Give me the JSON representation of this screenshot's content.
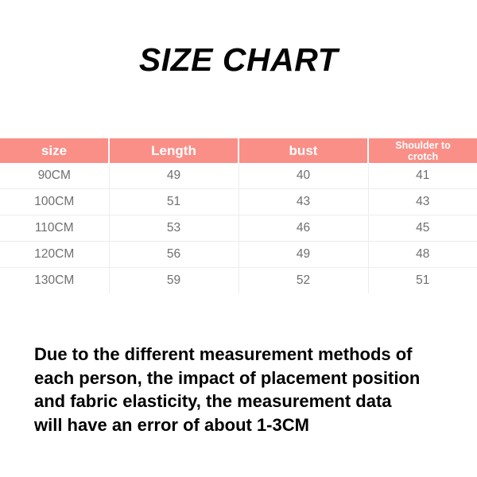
{
  "page": {
    "title": "SIZE CHART",
    "background_color": "#ffffff"
  },
  "colors": {
    "header_background": "#fa8f88",
    "header_text": "#ffffff",
    "body_text": "#6f6f6f",
    "title_text": "#050505",
    "row_divider": "#ededed",
    "disclaimer_text": "#000000"
  },
  "table": {
    "headers": [
      {
        "label": "size",
        "lines": [
          "size"
        ]
      },
      {
        "label": "Length",
        "lines": [
          "Length"
        ]
      },
      {
        "label": "bust",
        "lines": [
          "bust"
        ]
      },
      {
        "label": "Shoulder to crotch",
        "lines": [
          "Shoulder to",
          "crotch"
        ]
      }
    ],
    "rows": [
      {
        "size": "90CM",
        "length": "49",
        "bust": "40",
        "shoulder_to_crotch": "41"
      },
      {
        "size": "100CM",
        "length": "51",
        "bust": "43",
        "shoulder_to_crotch": "43"
      },
      {
        "size": "110CM",
        "length": "53",
        "bust": "46",
        "shoulder_to_crotch": "45"
      },
      {
        "size": "120CM",
        "length": "56",
        "bust": "49",
        "shoulder_to_crotch": "48"
      },
      {
        "size": "130CM",
        "length": "59",
        "bust": "52",
        "shoulder_to_crotch": "51"
      }
    ]
  },
  "disclaimer": {
    "lines": [
      "Due to the different measurement methods of",
      "each person, the impact of placement position",
      "and fabric elasticity, the measurement data",
      "will have an error of about 1-3CM"
    ]
  },
  "chart_data": {
    "type": "table",
    "title": "SIZE CHART",
    "columns": [
      "size",
      "Length",
      "bust",
      "Shoulder to crotch"
    ],
    "categories": [
      "90CM",
      "100CM",
      "110CM",
      "120CM",
      "130CM"
    ],
    "series": [
      {
        "name": "Length",
        "values": [
          49,
          51,
          53,
          56,
          59
        ]
      },
      {
        "name": "bust",
        "values": [
          40,
          43,
          46,
          49,
          52
        ]
      },
      {
        "name": "Shoulder to crotch",
        "values": [
          41,
          43,
          45,
          48,
          51
        ]
      }
    ],
    "units": "CM",
    "note": "Due to the different measurement methods of each person, the impact of placement position and fabric elasticity, the measurement data will have an error of about 1-3CM"
  }
}
